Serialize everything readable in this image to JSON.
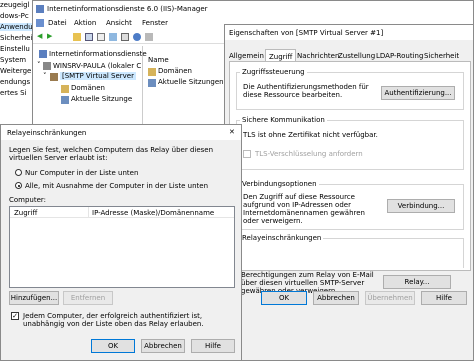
{
  "left_strip": {
    "items": [
      "zeugeigl",
      "dows-Pc",
      "Anwendu",
      "Sicherhei",
      "Einstellu",
      "System",
      "Weitergel",
      "endungs",
      "ertes Si"
    ]
  },
  "iis": {
    "title": "Internetinformationsdienste 6.0 (IIS)-Manager",
    "menu": [
      "Datei",
      "Aktion",
      "Ansicht",
      "Fenster"
    ],
    "tree": {
      "root": "Internetinformationsdienste",
      "server": "WINSRV-PAULA (lokaler C",
      "smtp": "[SMTP Virtual Server",
      "domains": "Domänen",
      "sessions": "Aktuelle Sitzunge"
    },
    "list": {
      "header": "Name",
      "items": [
        "Domänen",
        "Aktuelle Sitzungen"
      ]
    }
  },
  "props": {
    "title": "Eigenschaften von [SMTP Virtual Server #1]",
    "tabs": [
      "Allgemein",
      "Zugriff",
      "Nachrichten",
      "Zustellung",
      "LDAP-Routing",
      "Sicherheit"
    ],
    "active_tab": "Zugriff",
    "access_control": {
      "title": "Zugriffssteuerung",
      "text": "Die Authentifizierungsmethoden für diese Ressource bearbeiten.",
      "button": "Authentifizierung..."
    },
    "secure_comm": {
      "title": "Sichere Kommunikation",
      "text": "TLS ist ohne Zertifikat nicht verfügbar.",
      "checkbox": "TLS-Verschlüsselung anfordern"
    },
    "connection": {
      "title": "Verbindungsoptionen",
      "text": "Den Zugriff auf diese Ressource aufgrund von IP-Adressen oder Internetdomänennamen gewähren oder verweigern.",
      "button": "Verbindung..."
    },
    "relay": {
      "title": "Relayeinschränkungen",
      "text": "Berechtigungen zum Relay von E-Mail über diesen virtuellen SMTP-Server gewähren oder verweigern.",
      "button": "Relay..."
    },
    "buttons": {
      "ok": "OK",
      "cancel": "Abbrechen",
      "apply": "Übernehmen",
      "help": "Hilfe"
    }
  },
  "relay_dialog": {
    "title": "Relayeinschränkungen",
    "close": "✕",
    "intro": "Legen Sie fest, welchen Computern das Relay über diesen virtuellen Server erlaubt ist:",
    "radio_only": "Nur Computer in der Liste unten",
    "radio_all": "Alle, mit Ausnahme der Computer in der Liste unten",
    "computer_label": "Computer:",
    "columns": [
      "Zugriff",
      "IP-Adresse (Maske)/Domänenname"
    ],
    "add_button": "Hinzufügen...",
    "remove_button": "Entfernen",
    "auth_checkbox": "Jedem Computer, der erfolgreich authentifiziert ist, unabhängig von der Liste oben das Relay erlauben.",
    "buttons": {
      "ok": "OK",
      "cancel": "Abbrechen",
      "help": "Hilfe"
    }
  }
}
